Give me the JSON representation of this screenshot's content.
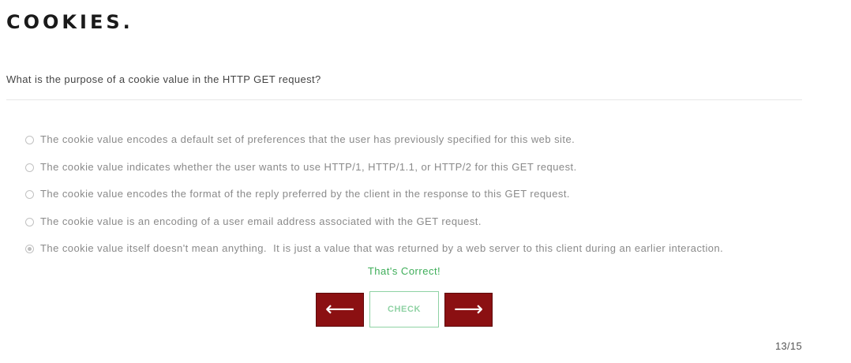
{
  "quiz": {
    "title": "COOKIES.",
    "question": "What is the purpose of a cookie value in the HTTP GET request?",
    "options": [
      {
        "label": "The cookie value encodes a default set of preferences that the user has previously specified for this web site.",
        "selected": false
      },
      {
        "label": "The cookie value indicates whether the user wants to use HTTP/1, HTTP/1.1, or HTTP/2 for this GET request.",
        "selected": false
      },
      {
        "label": "The cookie value encodes the format of the reply preferred by the client in the response to this GET request.",
        "selected": false
      },
      {
        "label": "The cookie value is an encoding of a user email address associated with the GET request.",
        "selected": false
      },
      {
        "label": "The cookie value itself doesn't mean anything.  It is just a value that was returned by a web server to this client during an earlier interaction.",
        "selected": true
      }
    ],
    "feedback": "That's Correct!",
    "progress": "13/15"
  },
  "nav": {
    "prev_label": "⟵",
    "check_label": "CHECK",
    "next_label": "⟶",
    "prev_icon": "arrow-left-icon",
    "next_icon": "arrow-right-icon"
  },
  "colors": {
    "title": "#1a1a1a",
    "feedback_correct": "#3fae5a",
    "nav_button": "#8b1012",
    "check_border": "#8fd2a4",
    "option_text": "#8a8a8a"
  }
}
